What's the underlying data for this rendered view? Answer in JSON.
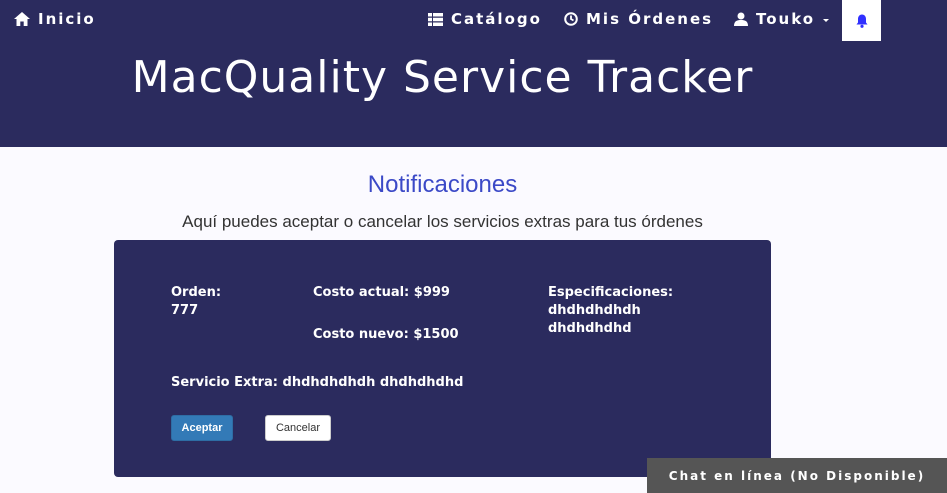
{
  "nav": {
    "home_label": "Inicio",
    "catalog_label": "Catálogo",
    "orders_label": "Mis Órdenes",
    "user_label": "Touko"
  },
  "header": {
    "title": "MacQuality Service Tracker"
  },
  "page": {
    "heading": "Notificaciones",
    "description": "Aquí puedes aceptar o cancelar los servicios extras para tus órdenes"
  },
  "notification": {
    "order_label": "Orden:",
    "order_value": "777",
    "current_cost": "Costo actual: $999",
    "new_cost": "Costo nuevo: $1500",
    "specs_label": "Especificaciones:",
    "specs_line1": "dhdhdhdhdh",
    "specs_line2": "dhdhdhdhd",
    "extra_service": "Servicio Extra: dhdhdhdhdh dhdhdhdhd",
    "accept_label": "Aceptar",
    "cancel_label": "Cancelar"
  },
  "chat": {
    "label": "Chat en línea (No Disponible)"
  },
  "colors": {
    "header_bg": "#2b2b5e",
    "heading_blue": "#3b49c7",
    "accept_blue": "#337ab7",
    "bell_blue": "#3030ff"
  },
  "icons": {
    "home": "home-icon",
    "catalog": "grid-list-icon",
    "orders": "clock-icon",
    "user": "user-icon",
    "bell": "bell-icon"
  }
}
